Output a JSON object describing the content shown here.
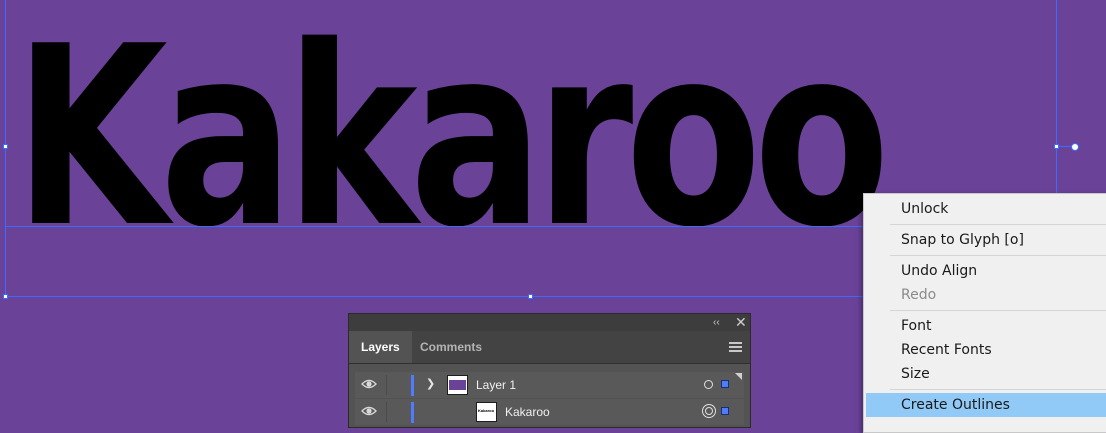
{
  "artboard": {
    "text": "Kakaroo",
    "background_color": "#6a4399",
    "text_color": "#000000",
    "selection_color": "#3b6cff"
  },
  "layers_panel": {
    "tabs": [
      {
        "label": "Layers",
        "active": true
      },
      {
        "label": "Comments",
        "active": false
      }
    ],
    "collapse_icon": "double-chevron-left-icon",
    "close_icon": "close-icon",
    "menu_icon": "hamburger-menu-icon",
    "layers": [
      {
        "name": "Layer 1",
        "visible": true,
        "expanded": true,
        "thumbnail_text": ""
      },
      {
        "name": "Kakaroo",
        "visible": true,
        "thumbnail_text": "Kakaroo"
      }
    ],
    "layer_color": "#4f7cff"
  },
  "context_menu": {
    "items": [
      {
        "label": "Unlock",
        "enabled": true
      },
      {
        "label": "Snap to Glyph [o]",
        "enabled": true
      },
      {
        "label": "Undo Align",
        "enabled": true
      },
      {
        "label": "Redo",
        "enabled": false
      },
      {
        "label": "Font",
        "enabled": true
      },
      {
        "label": "Recent Fonts",
        "enabled": true
      },
      {
        "label": "Size",
        "enabled": true
      },
      {
        "label": "Create Outlines",
        "enabled": true,
        "highlighted": true
      }
    ]
  }
}
